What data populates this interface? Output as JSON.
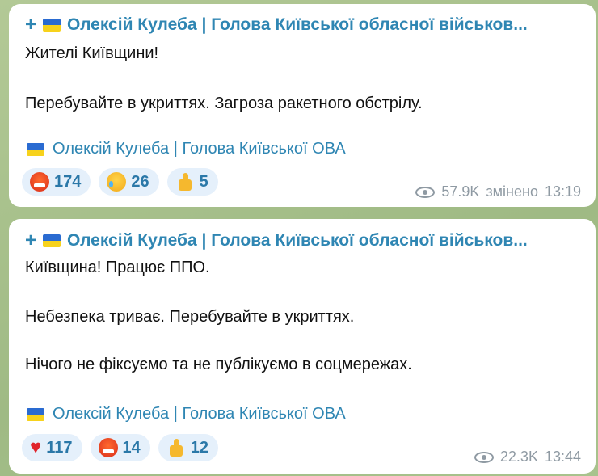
{
  "messages": [
    {
      "channel_title": "Олексій Кулеба | Голова Київської обласної військов...",
      "lines": [
        "Жителі Київщини!",
        "Перебувайте в укриттях. Загроза ракетного обстрілу."
      ],
      "signature": "Олексій Кулеба | Голова Київської ОВА",
      "reactions": [
        {
          "icon": "angry-face-icon",
          "count": "174"
        },
        {
          "icon": "crying-face-icon",
          "count": "26"
        },
        {
          "icon": "thumbs-up-icon",
          "count": "5"
        }
      ],
      "views": "57.9K",
      "edited": "змінено",
      "time": "13:19"
    },
    {
      "channel_title": "Олексій Кулеба | Голова Київської обласної військов...",
      "lines": [
        "Київщина! Працює ППО.",
        "Небезпека триває. Перебувайте в укриттях.",
        "Нічого не фіксуємо та не публікуємо в соцмережах."
      ],
      "signature": "Олексій Кулеба | Голова Київської ОВА",
      "reactions": [
        {
          "icon": "heart-icon",
          "count": "117"
        },
        {
          "icon": "angry-face-icon",
          "count": "14"
        },
        {
          "icon": "thumbs-up-icon",
          "count": "12"
        }
      ],
      "views": "22.3K",
      "time": "13:44"
    }
  ],
  "colors": {
    "accent": "#2f86b3",
    "reaction_bg": "#e5f0fb",
    "meta": "#8f9aa3",
    "chat_bg": "#a9c28c"
  }
}
